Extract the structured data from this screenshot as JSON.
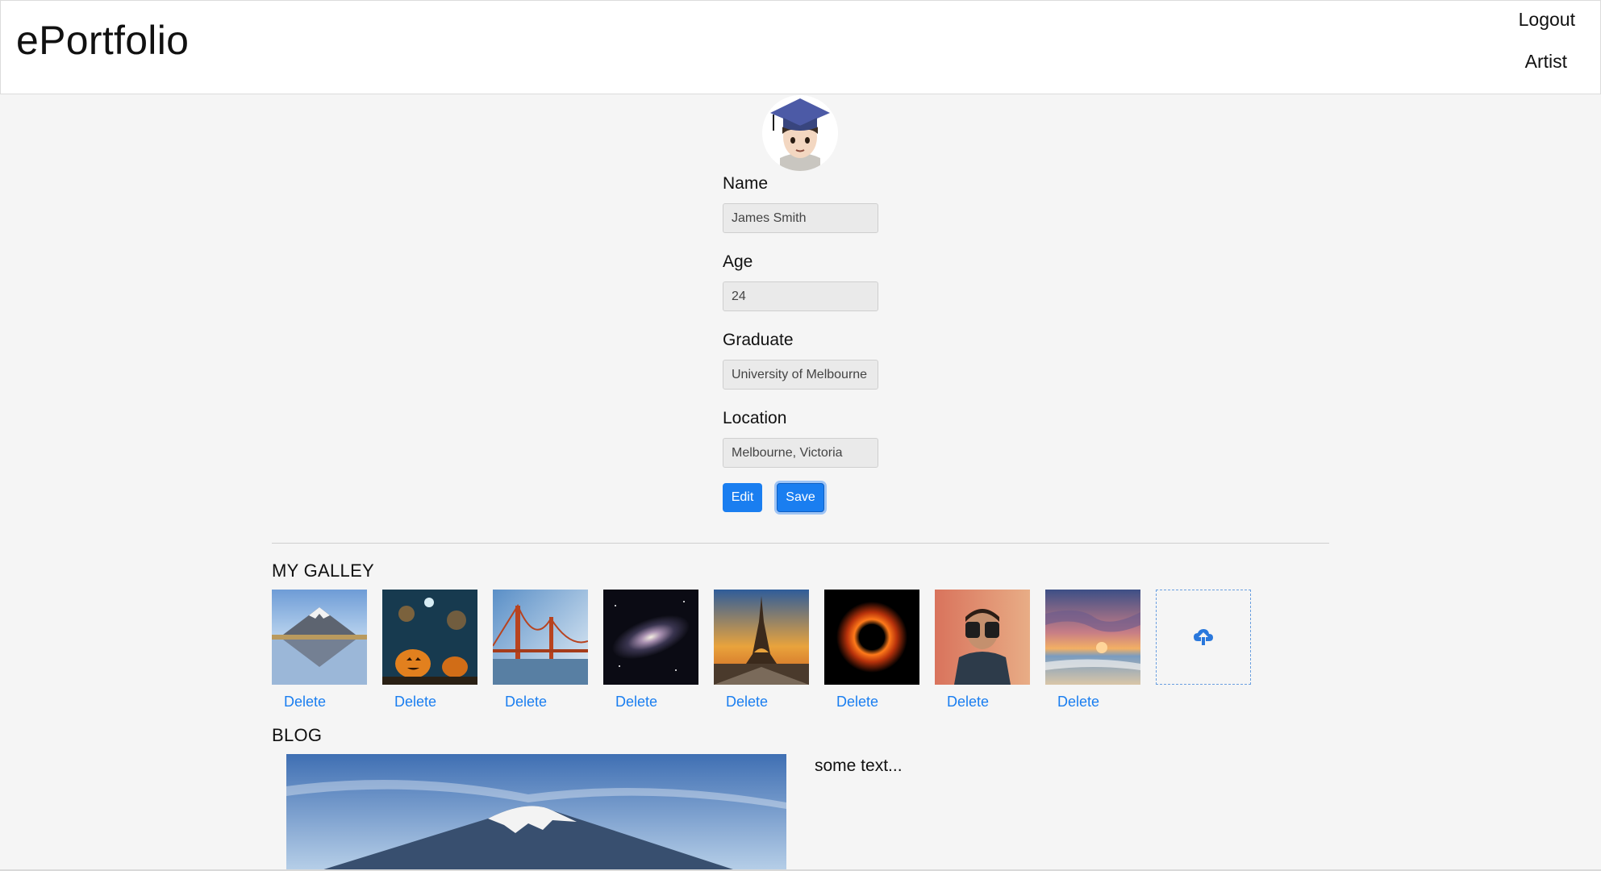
{
  "header": {
    "brand": "ePortfolio",
    "links": {
      "logout": "Logout",
      "artist": "Artist"
    }
  },
  "profile": {
    "fields": [
      {
        "label": "Name",
        "value": "James Smith"
      },
      {
        "label": "Age",
        "value": "24"
      },
      {
        "label": "Graduate",
        "value": "University of Melbourne"
      },
      {
        "label": "Location",
        "value": "Melbourne, Victoria"
      }
    ],
    "buttons": {
      "edit": "Edit",
      "save": "Save"
    }
  },
  "gallery": {
    "title": "MY GALLEY",
    "items": [
      {
        "icon": "mountain-reflection-image",
        "delete_label": "Delete"
      },
      {
        "icon": "halloween-pumpkins-image",
        "delete_label": "Delete"
      },
      {
        "icon": "golden-gate-bridge-image",
        "delete_label": "Delete"
      },
      {
        "icon": "galaxy-image",
        "delete_label": "Delete"
      },
      {
        "icon": "eiffel-tower-image",
        "delete_label": "Delete"
      },
      {
        "icon": "black-hole-image",
        "delete_label": "Delete"
      },
      {
        "icon": "person-binoculars-image",
        "delete_label": "Delete"
      },
      {
        "icon": "beach-sunset-image",
        "delete_label": "Delete"
      }
    ],
    "upload_icon": "cloud-upload-icon"
  },
  "blog": {
    "title": "BLOG",
    "text": "some text..."
  },
  "colors": {
    "accent": "#1a7ef0",
    "page_background": "#f5f5f5",
    "header_background": "#ffffff"
  }
}
